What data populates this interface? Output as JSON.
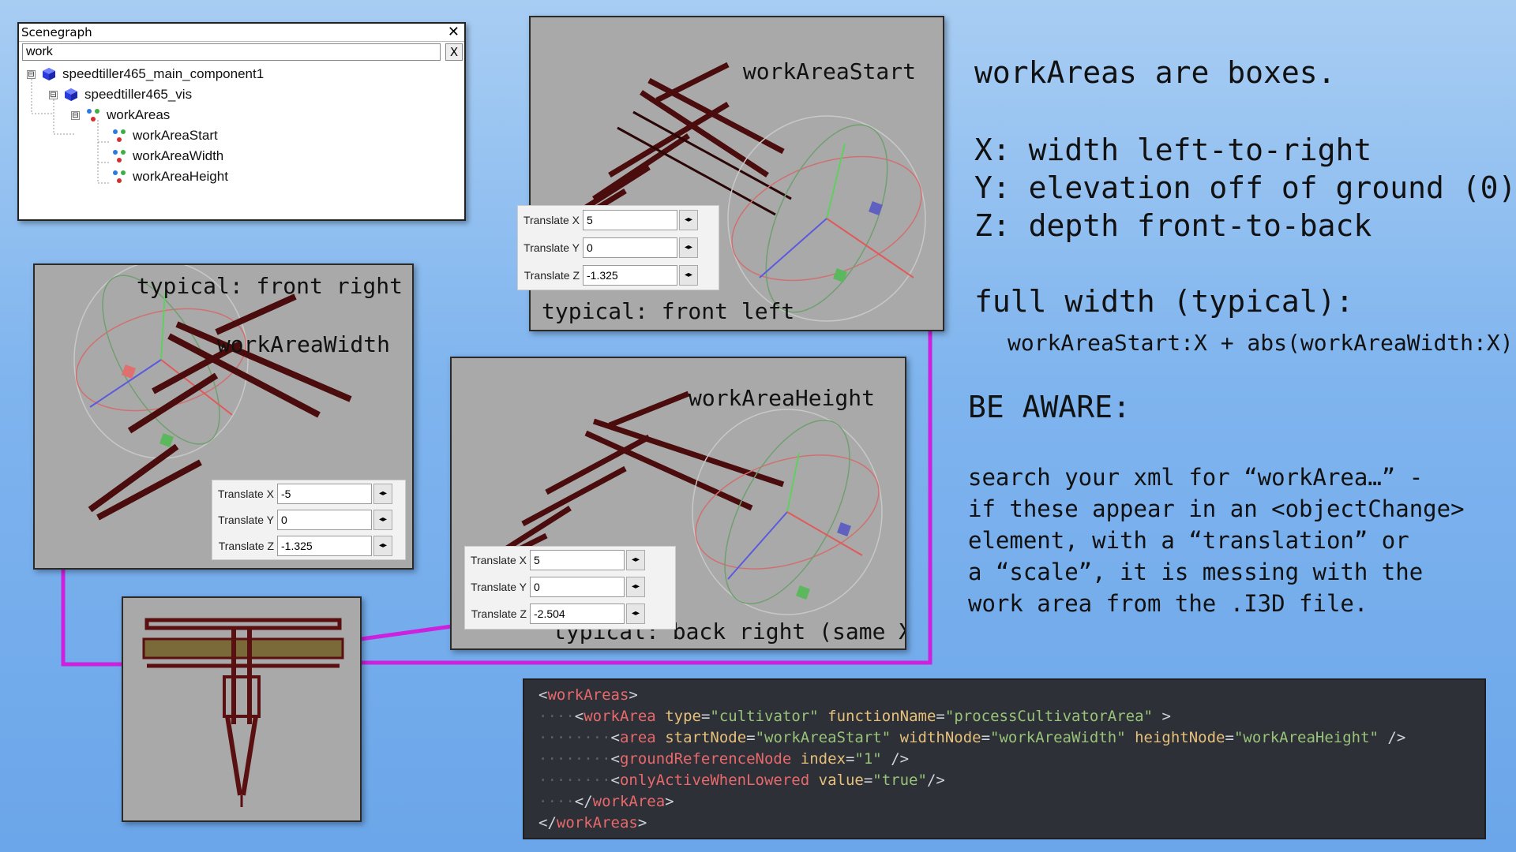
{
  "scenegraph": {
    "title": "Scenegraph",
    "close_label": "✕",
    "search_value": "work",
    "clear_label": "X",
    "tree": [
      {
        "label": "speedtiller465_main_component1",
        "expander": "⊟"
      },
      {
        "label": "speedtiller465_vis",
        "expander": "⊟"
      },
      {
        "label": "workAreas",
        "expander": "⊟"
      },
      {
        "label": "workAreaStart"
      },
      {
        "label": "workAreaWidth"
      },
      {
        "label": "workAreaHeight"
      }
    ]
  },
  "viewports": {
    "start": {
      "title": "workAreaStart",
      "caption": "typical: front left",
      "fields": [
        {
          "label": "Translate X",
          "value": "5"
        },
        {
          "label": "Translate Y",
          "value": "0"
        },
        {
          "label": "Translate Z",
          "value": "-1.325"
        }
      ]
    },
    "width": {
      "caption": "typical: front right",
      "title": "workAreaWidth",
      "fields": [
        {
          "label": "Translate X",
          "value": "-5"
        },
        {
          "label": "Translate Y",
          "value": "0"
        },
        {
          "label": "Translate Z",
          "value": "-1.325"
        }
      ]
    },
    "height": {
      "title": "workAreaHeight",
      "caption": "typical: back right (same X)",
      "fields": [
        {
          "label": "Translate X",
          "value": "5"
        },
        {
          "label": "Translate Y",
          "value": "0"
        },
        {
          "label": "Translate Z",
          "value": "-2.504"
        }
      ]
    }
  },
  "notes": {
    "heading": "workAreas are boxes.",
    "x": "X: width left-to-right",
    "y": "Y: elevation off of ground (0)",
    "z": "Z: depth front-to-back",
    "full_width_title": "full width (typical):",
    "full_width_formula": "workAreaStart:X + abs(workAreaWidth:X)",
    "aware_title": "BE AWARE:",
    "aware_lines": [
      "search your xml for “workArea…” -",
      "if these appear in an <objectChange>",
      "element, with a “translation” or",
      "a “scale”, it is messing with the",
      "work area from the .I3D file."
    ]
  },
  "code": {
    "l1_open": "<",
    "l1_tag": "workAreas",
    "l1_close": ">",
    "l2_tag": "workArea",
    "l2_attr1": "type",
    "l2_val1": "\"cultivator\"",
    "l2_attr2": "functionName",
    "l2_val2": "\"processCultivatorArea\"",
    "l3_tag": "area",
    "l3_attr1": "startNode",
    "l3_val1": "\"workAreaStart\"",
    "l3_attr2": "widthNode",
    "l3_val2": "\"workAreaWidth\"",
    "l3_attr3": "heightNode",
    "l3_val3": "\"workAreaHeight\"",
    "l4_tag": "groundReferenceNode",
    "l4_attr": "index",
    "l4_val": "\"1\"",
    "l5_tag": "onlyActiveWhenLowered",
    "l5_attr": "value",
    "l5_val": "\"true\"",
    "l6_tag": "workArea",
    "l7_tag": "workAreas"
  },
  "colors": {
    "connector": "#cc22dd",
    "implement": "#5a1010",
    "gizmo_red": "#e05a5a",
    "gizmo_green": "#5fcf5f",
    "gizmo_blue": "#5a5adf"
  }
}
